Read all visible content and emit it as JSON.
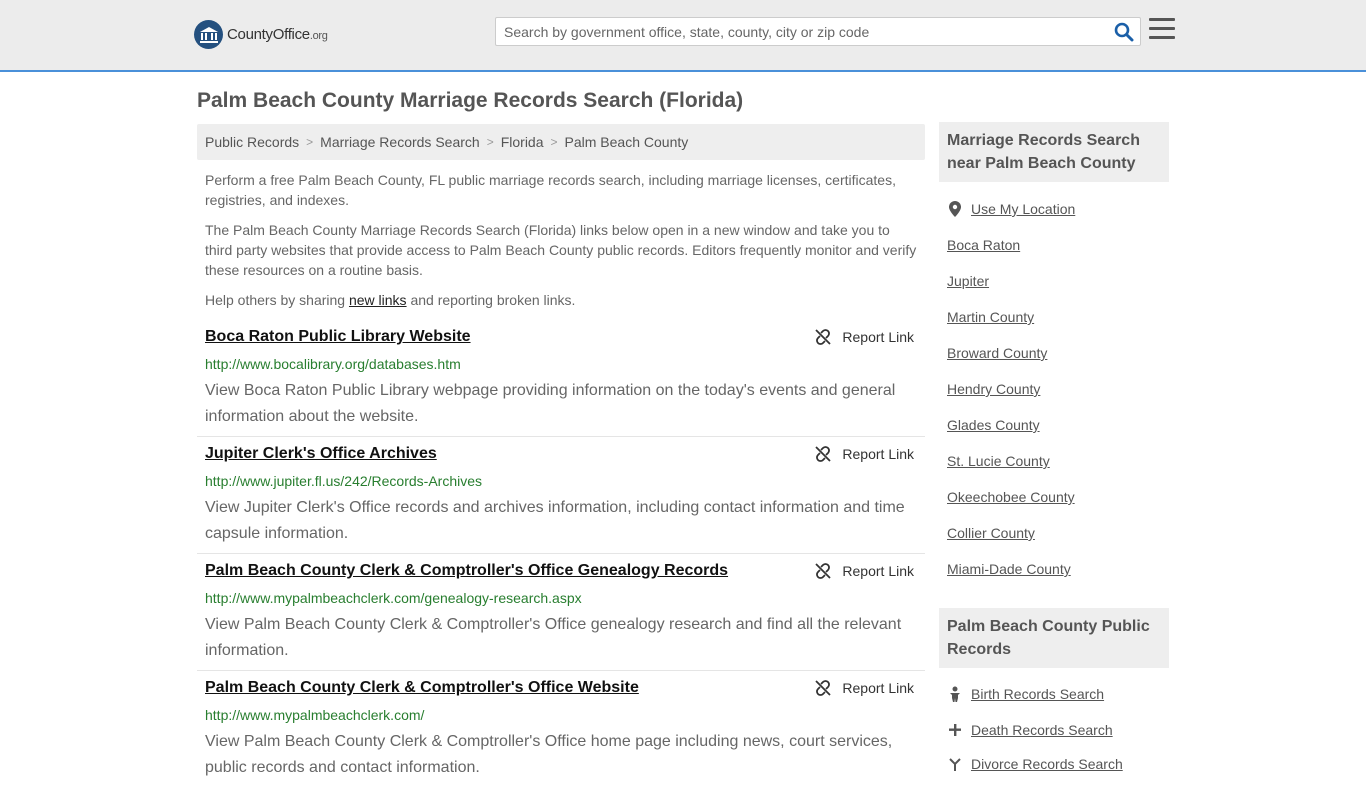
{
  "header": {
    "logo_text": "CountyOffice",
    "logo_suffix": ".org",
    "search_placeholder": "Search by government office, state, county, city or zip code"
  },
  "page": {
    "title": "Palm Beach County Marriage Records Search (Florida)"
  },
  "breadcrumb": [
    "Public Records",
    "Marriage Records Search",
    "Florida",
    "Palm Beach County"
  ],
  "intro": {
    "p1": "Perform a free Palm Beach County, FL public marriage records search, including marriage licenses, certificates, registries, and indexes.",
    "p2": "The Palm Beach County Marriage Records Search (Florida) links below open in a new window and take you to third party websites that provide access to Palm Beach County public records. Editors frequently monitor and verify these resources on a routine basis.",
    "p3_before": "Help others by sharing ",
    "p3_link": "new links",
    "p3_after": " and reporting broken links."
  },
  "report_label": "Report Link",
  "results": [
    {
      "title": "Boca Raton Public Library Website",
      "url": "http://www.bocalibrary.org/databases.htm",
      "desc": "View Boca Raton Public Library webpage providing information on the today's events and general information about the website."
    },
    {
      "title": "Jupiter Clerk's Office Archives",
      "url": "http://www.jupiter.fl.us/242/Records-Archives",
      "desc": "View Jupiter Clerk's Office records and archives information, including contact information and time capsule information."
    },
    {
      "title": "Palm Beach County Clerk & Comptroller's Office Genealogy Records",
      "url": "http://www.mypalmbeachclerk.com/genealogy-research.aspx",
      "desc": "View Palm Beach County Clerk & Comptroller's Office genealogy research and find all the relevant information."
    },
    {
      "title": "Palm Beach County Clerk & Comptroller's Office Website",
      "url": "http://www.mypalmbeachclerk.com/",
      "desc": "View Palm Beach County Clerk & Comptroller's Office home page including news, court services, public records and contact information."
    }
  ],
  "sidebar": {
    "nearby_heading": "Marriage Records Search near Palm Beach County",
    "use_location": "Use My Location",
    "nearby": [
      "Boca Raton",
      "Jupiter",
      "Martin County",
      "Broward County",
      "Hendry County",
      "Glades County",
      "St. Lucie County",
      "Okeechobee County",
      "Collier County",
      "Miami-Dade County"
    ],
    "public_heading": "Palm Beach County Public Records",
    "public_links": [
      {
        "label": "Birth Records Search",
        "icon": "baby-icon"
      },
      {
        "label": "Death Records Search",
        "icon": "cross-icon"
      },
      {
        "label": "Divorce Records Search",
        "icon": "split-icon"
      }
    ]
  },
  "colors": {
    "accent": "#4a90d9",
    "url_green": "#287e2f",
    "search_icon": "#1a5fa8"
  }
}
